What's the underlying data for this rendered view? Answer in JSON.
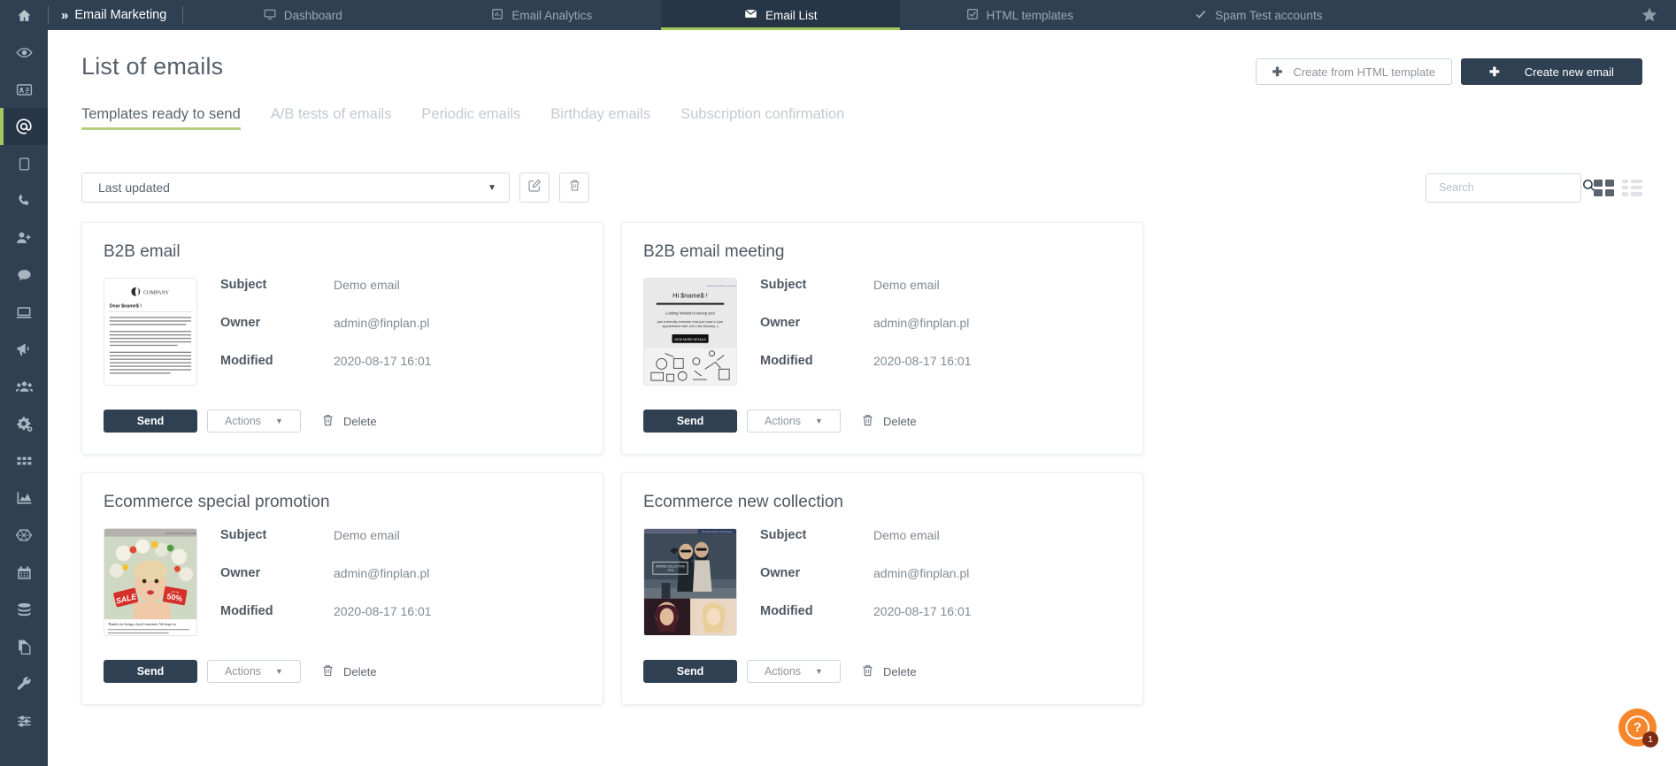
{
  "topbar": {
    "home_icon": "home-icon",
    "brand": "Email Marketing",
    "tabs": [
      {
        "label": "Dashboard",
        "icon": "monitor-icon",
        "active": false
      },
      {
        "label": "Email Analytics",
        "icon": "chart-box-icon",
        "active": false
      },
      {
        "label": "Email List",
        "icon": "envelope-icon",
        "active": true
      },
      {
        "label": "HTML templates",
        "icon": "checkbox-icon",
        "active": false
      },
      {
        "label": "Spam Test accounts",
        "icon": "check-icon",
        "active": false
      }
    ],
    "star_icon": "star-icon",
    "bg_color": "#2e4052",
    "active_tab_bg": "#273646",
    "accent_color": "#a4c65a"
  },
  "sidebar": {
    "items": [
      {
        "icon": "eye-icon",
        "active": false
      },
      {
        "icon": "contact-card-icon",
        "active": false
      },
      {
        "icon": "at-sign-icon",
        "active": true
      },
      {
        "icon": "tablet-icon",
        "active": false
      },
      {
        "icon": "phone-icon",
        "active": false
      },
      {
        "icon": "add-user-icon",
        "active": false
      },
      {
        "icon": "chat-bubble-icon",
        "active": false
      },
      {
        "icon": "laptop-icon",
        "active": false
      },
      {
        "icon": "megaphone-icon",
        "active": false
      },
      {
        "icon": "users-group-icon",
        "active": false
      },
      {
        "icon": "gears-icon",
        "active": false
      },
      {
        "icon": "grid-apps-icon",
        "active": false
      },
      {
        "icon": "area-chart-icon",
        "active": false
      },
      {
        "icon": "network-hexagon-icon",
        "active": false
      },
      {
        "icon": "calendar-icon",
        "active": false
      },
      {
        "icon": "database-icon",
        "active": false
      },
      {
        "icon": "copy-document-icon",
        "active": false
      },
      {
        "icon": "wrench-icon",
        "active": false
      },
      {
        "icon": "sliders-icon",
        "active": false
      }
    ]
  },
  "header": {
    "title": "List of emails",
    "create_from_template_label": "Create from HTML template",
    "create_new_label": "Create new email",
    "plus_icon": "plus-icon"
  },
  "subtabs": [
    {
      "label": "Templates ready to send",
      "active": true
    },
    {
      "label": "A/B tests of emails",
      "active": false
    },
    {
      "label": "Periodic emails",
      "active": false
    },
    {
      "label": "Birthday emails",
      "active": false
    },
    {
      "label": "Subscription confirmation",
      "active": false
    }
  ],
  "toolbar": {
    "sort_value": "Last updated",
    "sort_caret_icon": "chevron-down-icon",
    "edit_icon": "edit-square-icon",
    "delete_icon": "trash-icon",
    "search_placeholder": "Search",
    "search_value": "",
    "search_icon": "search-icon",
    "grid_view_icon": "grid-view-icon",
    "list_view_icon": "list-view-icon",
    "active_view": "grid"
  },
  "labels": {
    "subject": "Subject",
    "owner": "Owner",
    "modified": "Modified",
    "send": "Send",
    "actions": "Actions",
    "delete": "Delete"
  },
  "cards": [
    {
      "title": "B2B email",
      "subject": "Demo email",
      "owner": "admin@finplan.pl",
      "modified": "2020-08-17 16:01",
      "thumb": "b2b-letter-thumbnail",
      "thumb_text": "COMPANY"
    },
    {
      "title": "B2B email meeting",
      "subject": "Demo email",
      "owner": "admin@finplan.pl",
      "modified": "2020-08-17 16:01",
      "thumb": "meeting-reminder-thumbnail",
      "thumb_text": "Hi $name$ !"
    },
    {
      "title": "Ecommerce special promotion",
      "subject": "Demo email",
      "owner": "admin@finplan.pl",
      "modified": "2020-08-17 16:01",
      "thumb": "sale-promo-thumbnail",
      "thumb_text": "SALE"
    },
    {
      "title": "Ecommerce new collection",
      "subject": "Demo email",
      "owner": "admin@finplan.pl",
      "modified": "2020-08-17 16:01",
      "thumb": "new-collection-thumbnail",
      "thumb_text": "SPRING COLLECTION"
    }
  ],
  "help": {
    "icon": "question-mark-icon",
    "badge_count": "1",
    "color": "#f5862c"
  }
}
